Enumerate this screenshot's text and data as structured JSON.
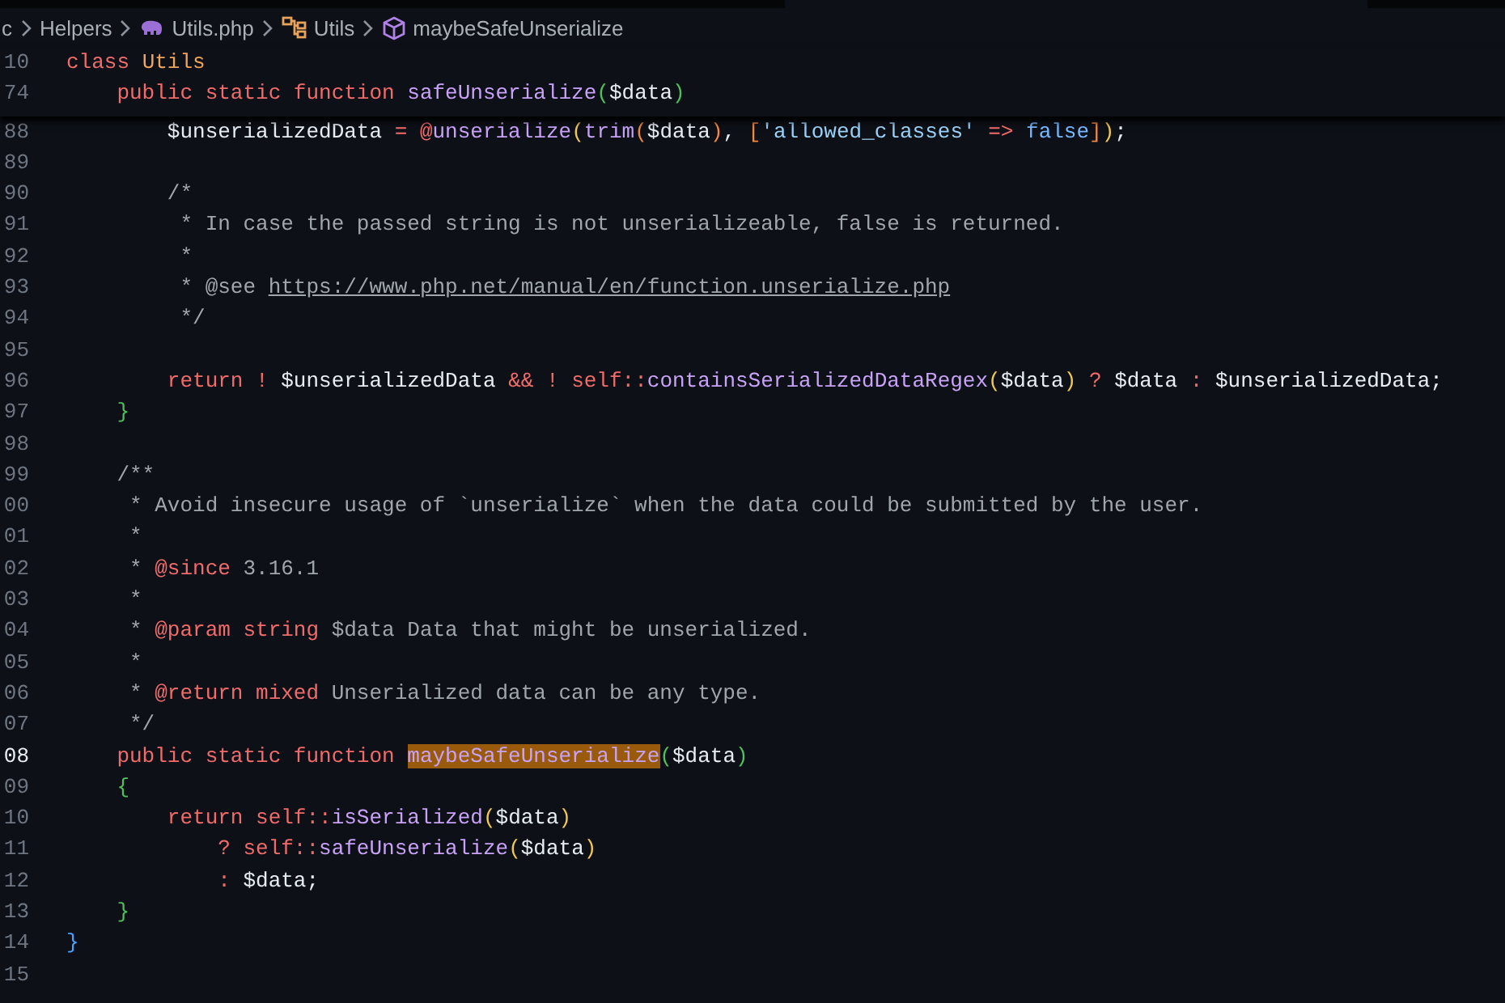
{
  "breadcrumb": [
    {
      "kind": "text",
      "label": "c"
    },
    {
      "kind": "folder",
      "label": "Helpers"
    },
    {
      "kind": "file",
      "label": "Utils.php"
    },
    {
      "kind": "class",
      "label": "Utils"
    },
    {
      "kind": "method",
      "label": "maybeSafeUnserialize"
    }
  ],
  "sticky_lines": [
    {
      "number": "10",
      "current": false,
      "tokens": [
        {
          "kind": "kw",
          "t": "class "
        },
        {
          "kind": "cls",
          "t": "Utils"
        }
      ]
    },
    {
      "number": "74",
      "current": false,
      "tokens": [
        {
          "kind": "kw",
          "t": "    public static function "
        },
        {
          "kind": "fn",
          "t": "safeUnserialize"
        },
        {
          "kind": "b2",
          "t": "("
        },
        {
          "kind": "var",
          "t": "$data"
        },
        {
          "kind": "b2",
          "t": ")"
        }
      ]
    }
  ],
  "lines": [
    {
      "number": "88",
      "current": false,
      "tokens": [
        {
          "kind": "var",
          "t": "        $unserializedData "
        },
        {
          "kind": "op",
          "t": "= @"
        },
        {
          "kind": "fn",
          "t": "unserialize"
        },
        {
          "kind": "b1",
          "t": "("
        },
        {
          "kind": "fn",
          "t": "trim"
        },
        {
          "kind": "b4",
          "t": "("
        },
        {
          "kind": "var",
          "t": "$data"
        },
        {
          "kind": "b4",
          "t": ")"
        },
        {
          "kind": "var",
          "t": ", "
        },
        {
          "kind": "b4",
          "t": "["
        },
        {
          "kind": "str",
          "t": "'allowed_classes' "
        },
        {
          "kind": "op",
          "t": "=> "
        },
        {
          "kind": "const",
          "t": "false"
        },
        {
          "kind": "b4",
          "t": "]"
        },
        {
          "kind": "b1",
          "t": ")"
        },
        {
          "kind": "var",
          "t": ";"
        }
      ]
    },
    {
      "number": "89",
      "current": false
    },
    {
      "number": "90",
      "current": false,
      "tokens": [
        {
          "kind": "cmt",
          "t": "        /*"
        }
      ]
    },
    {
      "number": "91",
      "current": false,
      "tokens": [
        {
          "kind": "cmt",
          "t": "         * In case the passed string is not unserializeable, false is returned."
        }
      ]
    },
    {
      "number": "92",
      "current": false,
      "tokens": [
        {
          "kind": "cmt",
          "t": "         *"
        }
      ]
    },
    {
      "number": "93",
      "current": false,
      "tokens": [
        {
          "kind": "cmt",
          "t": "         * @see "
        },
        {
          "kind": "link",
          "t": "https://www.php.net/manual/en/function.unserialize.php"
        }
      ]
    },
    {
      "number": "94",
      "current": false,
      "tokens": [
        {
          "kind": "cmt",
          "t": "         */"
        }
      ]
    },
    {
      "number": "95",
      "current": false
    },
    {
      "number": "96",
      "current": false,
      "tokens": [
        {
          "kind": "kw",
          "t": "        return ! "
        },
        {
          "kind": "var",
          "t": "$unserializedData "
        },
        {
          "kind": "kw",
          "t": "&& ! self::"
        },
        {
          "kind": "fn",
          "t": "containsSerializedDataRegex"
        },
        {
          "kind": "b1",
          "t": "("
        },
        {
          "kind": "var",
          "t": "$data"
        },
        {
          "kind": "b1",
          "t": ")"
        },
        {
          "kind": "kw",
          "t": " ? "
        },
        {
          "kind": "var",
          "t": "$data "
        },
        {
          "kind": "kw",
          "t": ": "
        },
        {
          "kind": "var",
          "t": "$unserializedData;"
        }
      ]
    },
    {
      "number": "97",
      "current": false,
      "tokens": [
        {
          "kind": "b2",
          "t": "    }"
        }
      ]
    },
    {
      "number": "98",
      "current": false
    },
    {
      "number": "99",
      "current": false,
      "tokens": [
        {
          "kind": "cmt",
          "t": "    /**"
        }
      ]
    },
    {
      "number": "00",
      "current": false,
      "tokens": [
        {
          "kind": "cmt",
          "t": "     * Avoid insecure usage of `unserialize` when the data could be submitted by the user."
        }
      ]
    },
    {
      "number": "01",
      "current": false,
      "tokens": [
        {
          "kind": "cmt",
          "t": "     *"
        }
      ]
    },
    {
      "number": "02",
      "current": false,
      "tokens": [
        {
          "kind": "cmt",
          "t": "     * "
        },
        {
          "kind": "tag",
          "t": "@since"
        },
        {
          "kind": "cmt",
          "t": " 3.16.1"
        }
      ]
    },
    {
      "number": "03",
      "current": false,
      "tokens": [
        {
          "kind": "cmt",
          "t": "     *"
        }
      ]
    },
    {
      "number": "04",
      "current": false,
      "tokens": [
        {
          "kind": "cmt",
          "t": "     * "
        },
        {
          "kind": "tag",
          "t": "@param string"
        },
        {
          "kind": "cmt",
          "t": " $data Data that might be unserialized."
        }
      ]
    },
    {
      "number": "05",
      "current": false,
      "tokens": [
        {
          "kind": "cmt",
          "t": "     *"
        }
      ]
    },
    {
      "number": "06",
      "current": false,
      "tokens": [
        {
          "kind": "cmt",
          "t": "     * "
        },
        {
          "kind": "tag",
          "t": "@return mixed"
        },
        {
          "kind": "cmt",
          "t": " Unserialized data can be any type."
        }
      ]
    },
    {
      "number": "07",
      "current": false,
      "tokens": [
        {
          "kind": "cmt",
          "t": "     */"
        }
      ]
    },
    {
      "number": "08",
      "current": true,
      "tokens": [
        {
          "kind": "kw",
          "t": "    public static function "
        },
        {
          "kind": "match",
          "t": "maybeSafeUnserialize"
        },
        {
          "kind": "b2",
          "t": "("
        },
        {
          "kind": "var",
          "t": "$data"
        },
        {
          "kind": "b2",
          "t": ")"
        }
      ]
    },
    {
      "number": "09",
      "current": false,
      "tokens": [
        {
          "kind": "b2",
          "t": "    {"
        }
      ]
    },
    {
      "number": "10",
      "current": false,
      "tokens": [
        {
          "kind": "kw",
          "t": "        return self::"
        },
        {
          "kind": "fn",
          "t": "isSerialized"
        },
        {
          "kind": "b1",
          "t": "("
        },
        {
          "kind": "var",
          "t": "$data"
        },
        {
          "kind": "b1",
          "t": ")"
        }
      ]
    },
    {
      "number": "11",
      "current": false,
      "tokens": [
        {
          "kind": "kw",
          "t": "            ? self::"
        },
        {
          "kind": "fn",
          "t": "safeUnserialize"
        },
        {
          "kind": "b1",
          "t": "("
        },
        {
          "kind": "var",
          "t": "$data"
        },
        {
          "kind": "b1",
          "t": ")"
        }
      ]
    },
    {
      "number": "12",
      "current": false,
      "tokens": [
        {
          "kind": "kw",
          "t": "            : "
        },
        {
          "kind": "var",
          "t": "$data;"
        }
      ]
    },
    {
      "number": "13",
      "current": false,
      "tokens": [
        {
          "kind": "b2",
          "t": "    }"
        }
      ]
    },
    {
      "number": "14",
      "current": false,
      "tokens": [
        {
          "kind": "b3",
          "t": "}"
        }
      ]
    },
    {
      "number": "15",
      "current": false
    }
  ]
}
